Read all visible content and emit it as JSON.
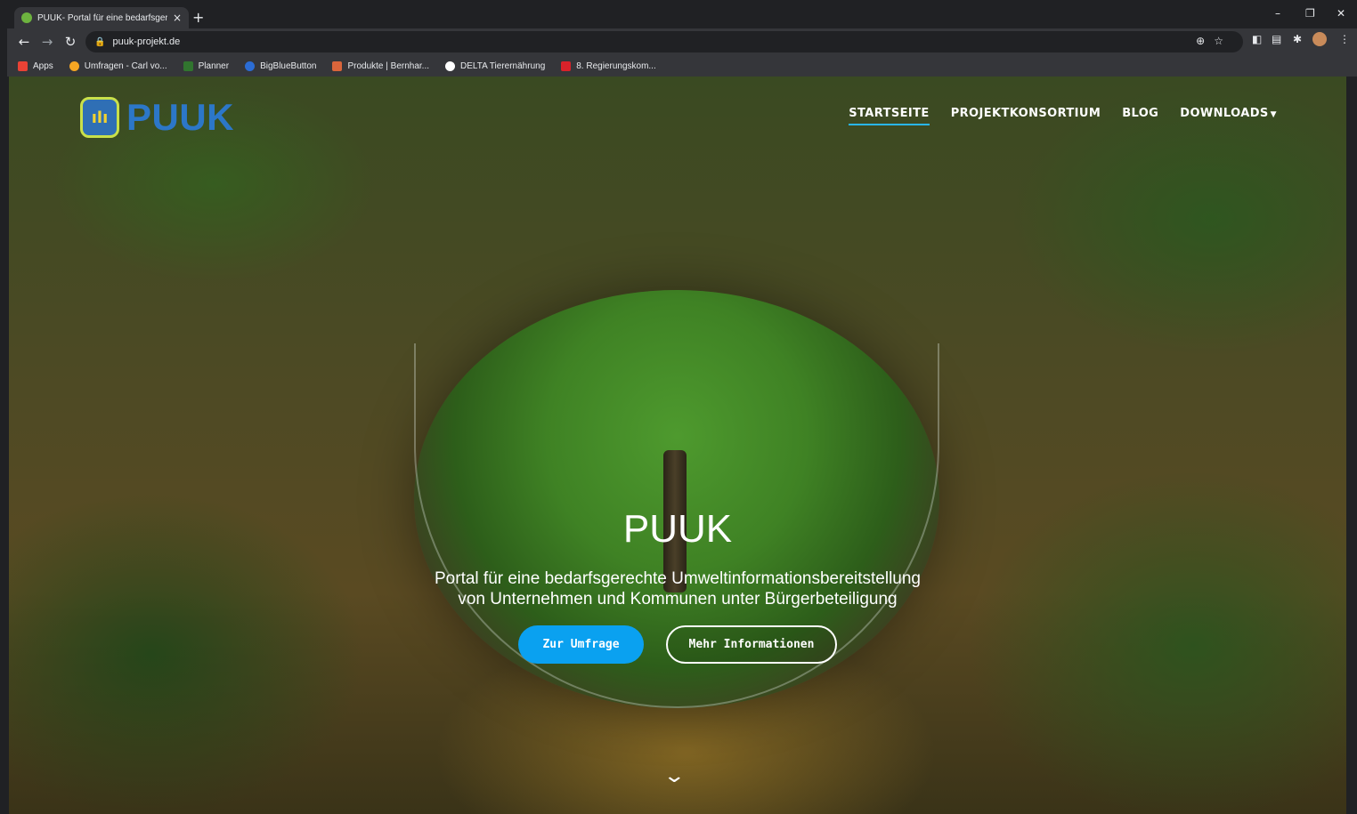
{
  "browser": {
    "tab_title": "PUUK- Portal für eine bedarfsger",
    "tab_close": "×",
    "new_tab": "+",
    "url": "puuk-projekt.de",
    "window_minimize": "–",
    "window_restore": "❐",
    "window_close": "✕",
    "bookmarks": [
      {
        "label": "Apps",
        "color": "#e94235"
      },
      {
        "label": "Umfragen - Carl vo...",
        "color": "#f5a623"
      },
      {
        "label": "Planner",
        "color": "#31752f"
      },
      {
        "label": "BigBlueButton",
        "color": "#2b6cd4"
      },
      {
        "label": "Produkte | Bernhar...",
        "color": "#d9653b"
      },
      {
        "label": "DELTA Tierernährung",
        "color": "#ffffff"
      },
      {
        "label": "8. Regierungskom...",
        "color": "#d8222a"
      }
    ]
  },
  "site": {
    "logo_text": "PUUK",
    "nav": [
      {
        "label": "STARTSEITE",
        "active": true
      },
      {
        "label": "PROJEKTKONSORTIUM",
        "active": false
      },
      {
        "label": "BLOG",
        "active": false
      },
      {
        "label": "DOWNLOADS",
        "active": false
      }
    ],
    "hero_title": "PUUK",
    "hero_subtitle_line1": "Portal für eine bedarfsgerechte Umweltinformationsbereitstellung",
    "hero_subtitle_line2": "von Unternehmen und Kommunen unter Bürgerbeteiligung",
    "primary_button": "Zur Umfrage",
    "secondary_button": "Mehr Informationen",
    "accent_color": "#0aa1f0"
  }
}
